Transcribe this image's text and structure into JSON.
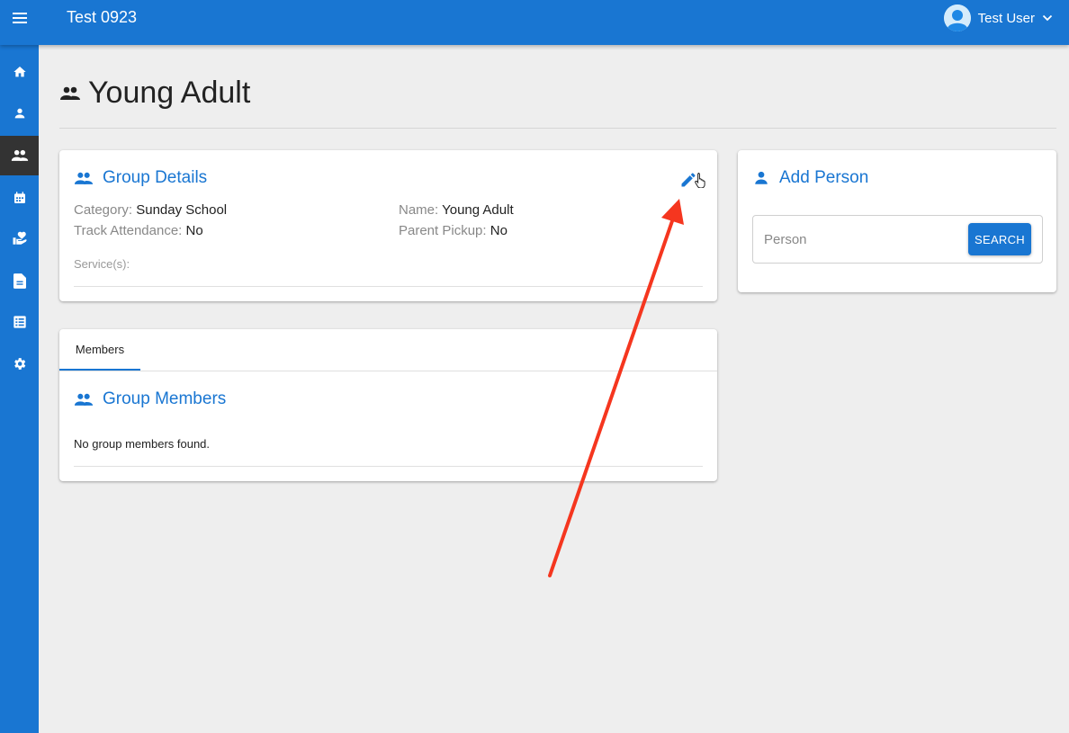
{
  "header": {
    "app_title": "Test 0923",
    "user_name": "Test User"
  },
  "sidebar": {
    "items": [
      {
        "icon": "home-icon",
        "active": false
      },
      {
        "icon": "person-icon",
        "active": false
      },
      {
        "icon": "groups-icon",
        "active": true
      },
      {
        "icon": "calendar-icon",
        "active": false
      },
      {
        "icon": "donations-icon",
        "active": false
      },
      {
        "icon": "document-icon",
        "active": false
      },
      {
        "icon": "list-icon",
        "active": false
      },
      {
        "icon": "settings-icon",
        "active": false
      }
    ]
  },
  "page": {
    "title": "Young Adult"
  },
  "group_details": {
    "title": "Group Details",
    "category_label": "Category:",
    "category_value": "Sunday School",
    "name_label": "Name:",
    "name_value": "Young Adult",
    "track_attendance_label": "Track Attendance:",
    "track_attendance_value": "No",
    "parent_pickup_label": "Parent Pickup:",
    "parent_pickup_value": "No",
    "services_label": "Service(s):"
  },
  "members": {
    "tab_label": "Members",
    "title": "Group Members",
    "empty_message": "No group members found."
  },
  "add_person": {
    "title": "Add Person",
    "search_placeholder": "Person",
    "search_button": "SEARCH"
  },
  "colors": {
    "primary": "#1976d2",
    "annotation_arrow": "#f5361f"
  }
}
